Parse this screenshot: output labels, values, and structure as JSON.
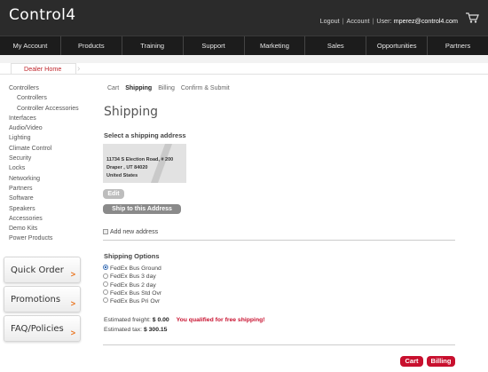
{
  "header": {
    "logo": "Control4",
    "logout": "Logout",
    "account": "Account",
    "user_label": "User:",
    "user_email": "mperez@control4.com"
  },
  "nav": [
    "My Account",
    "Products",
    "Training",
    "Support",
    "Marketing",
    "Sales",
    "Opportunities",
    "Partners"
  ],
  "breadcrumb": "Dealer Home",
  "sidebar": {
    "items": [
      {
        "label": "Controllers",
        "sub": false
      },
      {
        "label": "Controllers",
        "sub": true
      },
      {
        "label": "Controller Accessories",
        "sub": true
      },
      {
        "label": "Interfaces",
        "sub": false
      },
      {
        "label": "Audio/Video",
        "sub": false
      },
      {
        "label": "Lighting",
        "sub": false
      },
      {
        "label": "Climate Control",
        "sub": false
      },
      {
        "label": "Security",
        "sub": false
      },
      {
        "label": "Locks",
        "sub": false
      },
      {
        "label": "Networking",
        "sub": false
      },
      {
        "label": "Partners",
        "sub": false
      },
      {
        "label": "Software",
        "sub": false
      },
      {
        "label": "Speakers",
        "sub": false
      },
      {
        "label": "Accessories",
        "sub": false
      },
      {
        "label": "Demo Kits",
        "sub": false
      },
      {
        "label": "Power Products",
        "sub": false
      }
    ],
    "promos": [
      "Quick Order",
      "Promotions",
      "FAQ/Policies"
    ],
    "promo_arrow": ">"
  },
  "steps": [
    "Cart",
    "Shipping",
    "Billing",
    "Confirm & Submit"
  ],
  "page_title": "Shipping",
  "select_address_heading": "Select a shipping address",
  "address": [
    "11734 S Election Road, # 200",
    "Draper , UT 84020",
    "United States"
  ],
  "edit_label": "Edit",
  "ship_label": "Ship to this Address",
  "add_new_label": "Add new address",
  "shipping_options_heading": "Shipping Options",
  "shipping_options": [
    "FedEx Bus Ground",
    "FedEx Bus 3 day",
    "FedEx Bus 2 day",
    "FedEx Bus Std Ovr",
    "FedEx Bus Pri Ovr"
  ],
  "freight_label": "Estimated freight:",
  "freight_value": "$ 0.00",
  "free_msg": "You qualified for free shipping!",
  "tax_label": "Estimated tax:",
  "tax_value": "$ 300.15",
  "cart_button": "Cart",
  "billing_button": "Billing"
}
